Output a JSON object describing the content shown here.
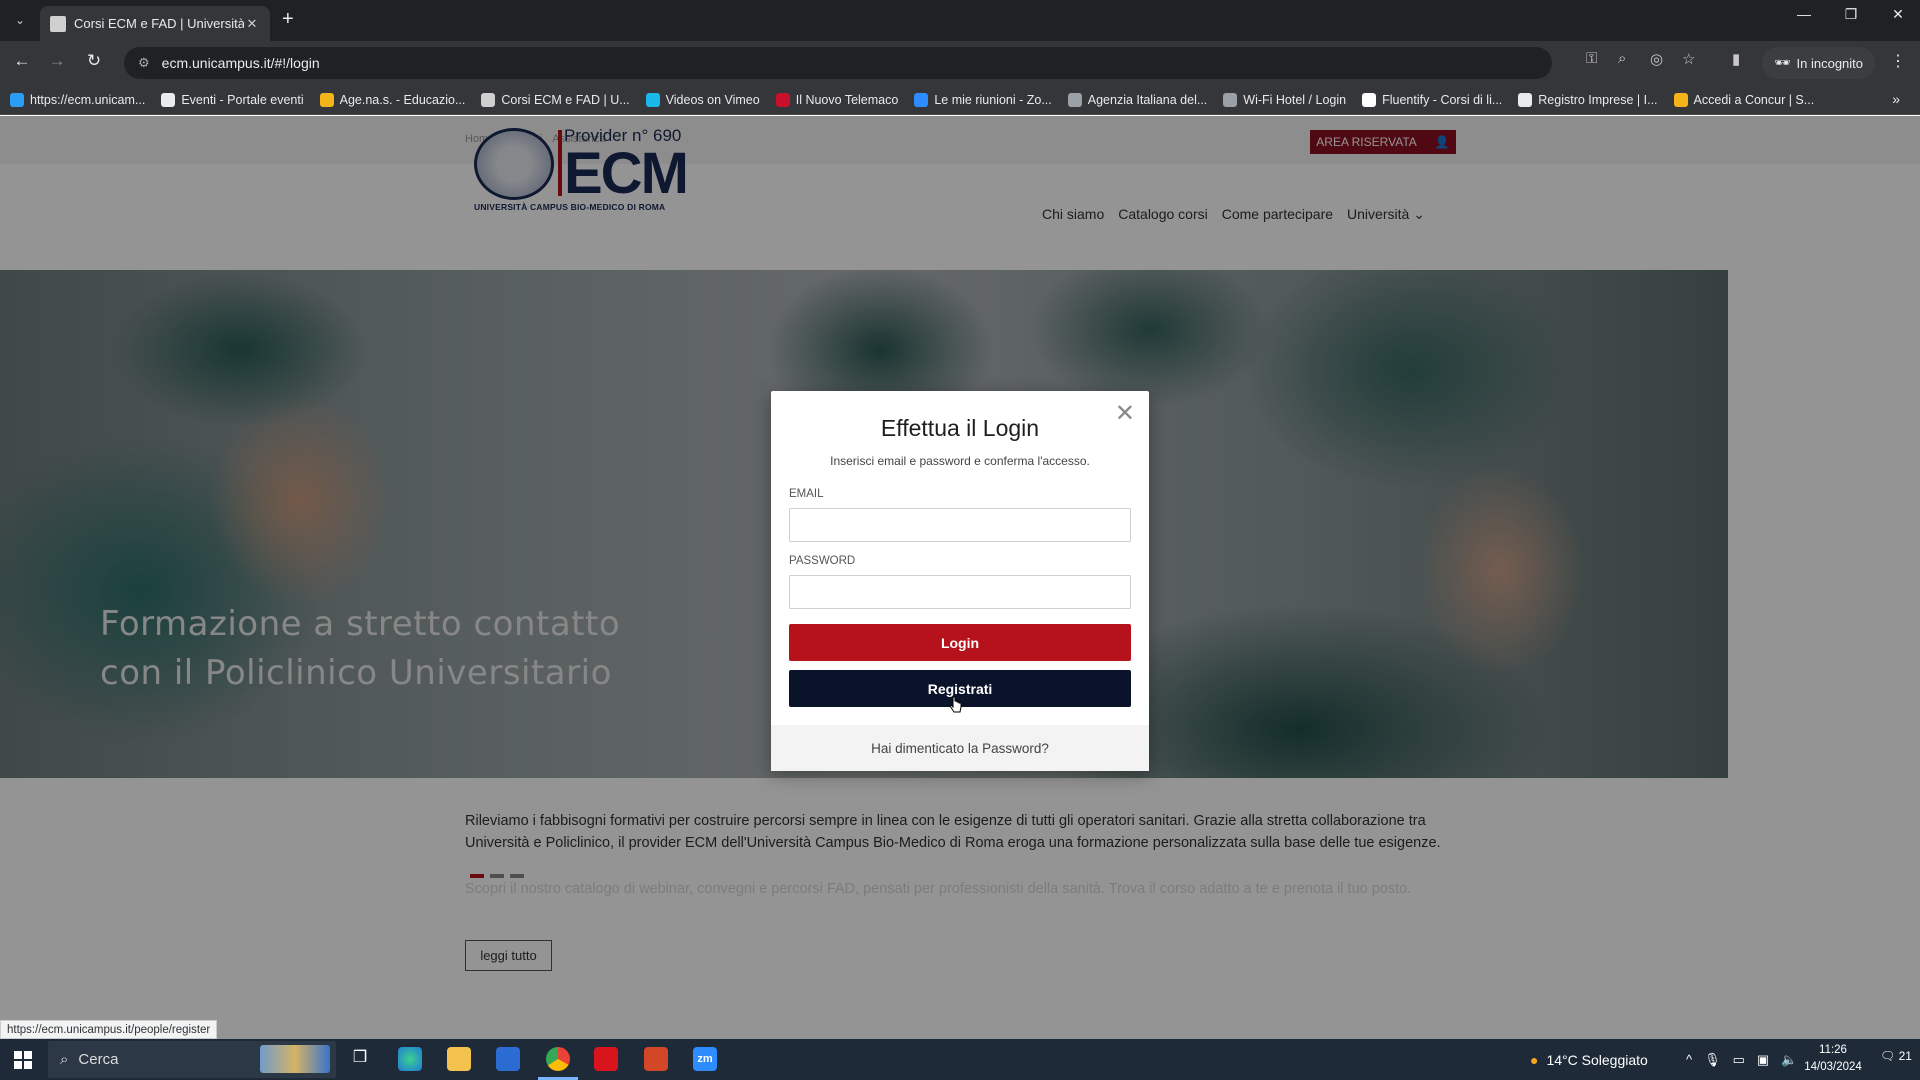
{
  "browser": {
    "tab_title": "Corsi ECM e FAD | Università Ca",
    "url": "ecm.unicampus.it/#!/login",
    "incognito_label": "In incognito",
    "bookmarks": [
      {
        "label": "https://ecm.unicam...",
        "color": "#2a9df4"
      },
      {
        "label": "Eventi - Portale eventi",
        "color": "#e8eaed"
      },
      {
        "label": "Age.na.s. - Educazio...",
        "color": "#f2b418"
      },
      {
        "label": "Corsi ECM e FAD | U...",
        "color": "#d0d0d0"
      },
      {
        "label": "Videos on Vimeo",
        "color": "#1ab7ea"
      },
      {
        "label": "Il Nuovo Telemaco",
        "color": "#c8102e"
      },
      {
        "label": "Le mie riunioni - Zo...",
        "color": "#2d8cff"
      },
      {
        "label": "Agenzia Italiana del...",
        "color": "#9aa0a6"
      },
      {
        "label": "Wi-Fi Hotel / Login",
        "color": "#9aa0a6"
      },
      {
        "label": "Fluentify - Corsi di li...",
        "color": "#ffffff"
      },
      {
        "label": "Registro Imprese | I...",
        "color": "#e8eaed"
      },
      {
        "label": "Accedi a Concur | S...",
        "color": "#f2b418"
      }
    ]
  },
  "site": {
    "top_links": [
      "Home",
      "Contatti",
      "Assistenza"
    ],
    "area_riservata": "AREA RISERVATA",
    "logo": {
      "provider": "Provider n° 690",
      "ecm": "ECM",
      "university": "UNIVERSITÀ CAMPUS BIO-MEDICO DI ROMA"
    },
    "nav": [
      "Chi siamo",
      "Catalogo corsi",
      "Come partecipare",
      "Università"
    ],
    "hero_title_line1": "Formazione a stretto contatto",
    "hero_title_line2": "con il Policlinico Universitario",
    "intro": "Rileviamo i fabbisogni formativi per costruire percorsi sempre in linea con le esigenze di tutti gli operatori sanitari. Grazie alla stretta collaborazione tra Università e Policlinico, il provider ECM dell'Università Campus Bio-Medico di Roma eroga una formazione personalizzata sulla base delle tue esigenze.",
    "intro_faded": "Scopri il nostro catalogo di webinar, convegni e percorsi FAD, pensati per professionisti della sanità. Trova il corso adatto a te e prenota il tuo posto.",
    "read_more": "leggi tutto"
  },
  "modal": {
    "title": "Effettua il Login",
    "subtitle": "Inserisci email e password e conferma l'accesso.",
    "email_label": "EMAIL",
    "email_value": "",
    "password_label": "PASSWORD",
    "password_value": "",
    "login_button": "Login",
    "register_button": "Registrati",
    "forgot_link": "Hai dimenticato la Password?"
  },
  "status_url": "https://ecm.unicampus.it/people/register",
  "taskbar": {
    "search_placeholder": "Cerca",
    "weather": "14°C Soleggiato",
    "time": "11:26",
    "date": "14/03/2024",
    "notifications": "21"
  },
  "colors": {
    "brand_red": "#b5121b",
    "brand_navy": "#0b132b",
    "area_riservata_bg": "#8a1020"
  }
}
